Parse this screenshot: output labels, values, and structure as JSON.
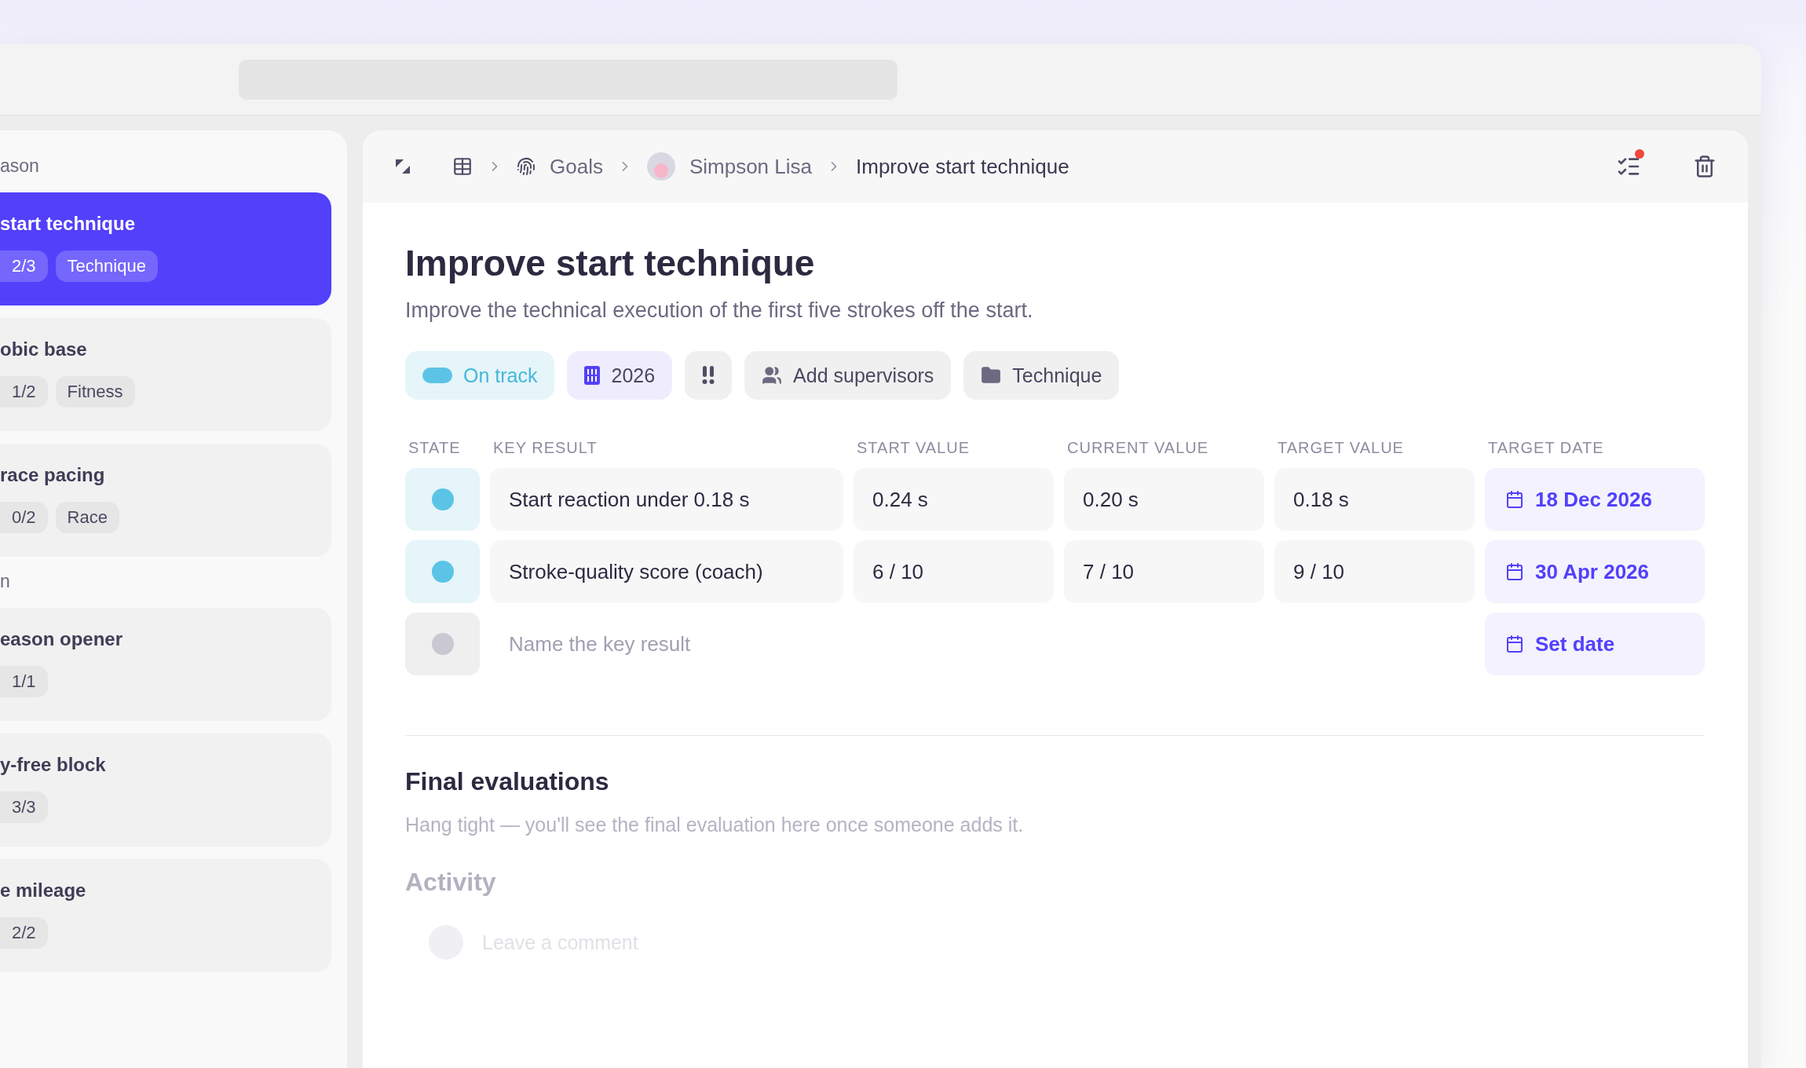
{
  "sidebar": {
    "sections": [
      {
        "label": "ason",
        "goals": [
          {
            "title": "start technique",
            "progress": "2/3",
            "tag": "Technique",
            "selected": true
          },
          {
            "title": "obic base",
            "progress": "1/2",
            "tag": "Fitness",
            "selected": false
          },
          {
            "title": "race pacing",
            "progress": "0/2",
            "tag": "Race",
            "selected": false
          }
        ]
      },
      {
        "label": "n",
        "goals": [
          {
            "title": "eason opener",
            "progress": "1/1",
            "selected": false
          },
          {
            "title": "y-free block",
            "progress": "3/3",
            "selected": false
          },
          {
            "title": "e mileage",
            "progress": "2/2",
            "selected": false
          }
        ]
      }
    ]
  },
  "breadcrumb": [
    "Goals",
    "Simpson Lisa",
    "Improve start technique"
  ],
  "header_actions": {
    "has_unread": true
  },
  "goal": {
    "title": "Improve start technique",
    "description": "Improve the technical execution of the first five strokes off the start.",
    "chips": [
      {
        "kind": "status",
        "label": "On track",
        "color": "#5bc4e6"
      },
      {
        "kind": "year",
        "label": "2026"
      },
      {
        "kind": "priority"
      },
      {
        "kind": "supervisors",
        "label": "Add supervisors"
      },
      {
        "kind": "category",
        "label": "Technique"
      }
    ]
  },
  "key_results": {
    "columns": [
      "STATE",
      "KEY RESULT",
      "START VALUE",
      "CURRENT VALUE",
      "TARGET VALUE",
      "TARGET DATE"
    ],
    "rows": [
      {
        "kind": "result",
        "color": "#5bc4e6",
        "name": "Start reaction under 0.18 s",
        "start": "0.24 s",
        "current": "0.20 s",
        "target": "0.18 s",
        "date": "18 Dec 2026"
      },
      {
        "kind": "result",
        "color": "#5bc4e6",
        "name": "Stroke-quality score (coach)",
        "start": "6 / 10",
        "current": "7 / 10",
        "target": "9 / 10",
        "date": "30 Apr 2026"
      },
      {
        "kind": "new",
        "color": "#c9c8d3",
        "placeholder": "Name the key result",
        "date": "Set date"
      }
    ]
  },
  "final_evaluations": {
    "title": "Final evaluations",
    "message": "Hang tight — you'll see the final evaluation here once someone adds it."
  },
  "activity": {
    "title": "Activity",
    "comment_placeholder": "Leave a comment"
  }
}
